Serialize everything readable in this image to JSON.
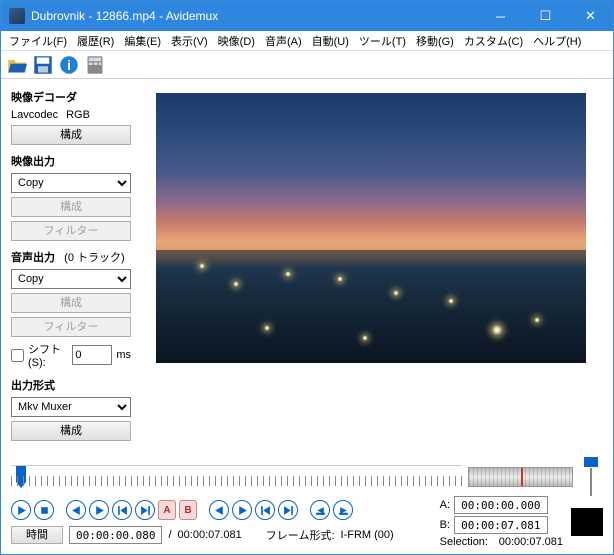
{
  "title": "Dubrovnik - 12866.mp4 - Avidemux",
  "menu": [
    "ファイル(F)",
    "履歴(R)",
    "編集(E)",
    "表示(V)",
    "映像(D)",
    "音声(A)",
    "自動(U)",
    "ツール(T)",
    "移動(G)",
    "カスタム(C)",
    "ヘルプ(H)"
  ],
  "decoder": {
    "label": "映像デコーダ",
    "codec": "Lavcodec",
    "mode": "RGB",
    "config": "構成"
  },
  "vout": {
    "label": "映像出力",
    "value": "Copy",
    "config": "構成",
    "filter": "フィルター"
  },
  "aout": {
    "label": "音声出力",
    "tracks": "(0 トラック)",
    "value": "Copy",
    "config": "構成",
    "filter": "フィルター"
  },
  "shift": {
    "label": "シフト(S):",
    "value": 0,
    "unit": "ms"
  },
  "format": {
    "label": "出力形式",
    "value": "Mkv Muxer",
    "config": "構成"
  },
  "time": {
    "btn": "時間",
    "current": "00:00:00.080",
    "sep": "/",
    "total": "00:00:07.081",
    "framelabel": "フレーム形式:",
    "frametype": "I-FRM (00)"
  },
  "ab": {
    "a_label": "A:",
    "a": "00:00:00.000",
    "b_label": "B:",
    "b": "00:00:07.081",
    "sel_label": "Selection:",
    "sel": "00:00:07.081"
  }
}
